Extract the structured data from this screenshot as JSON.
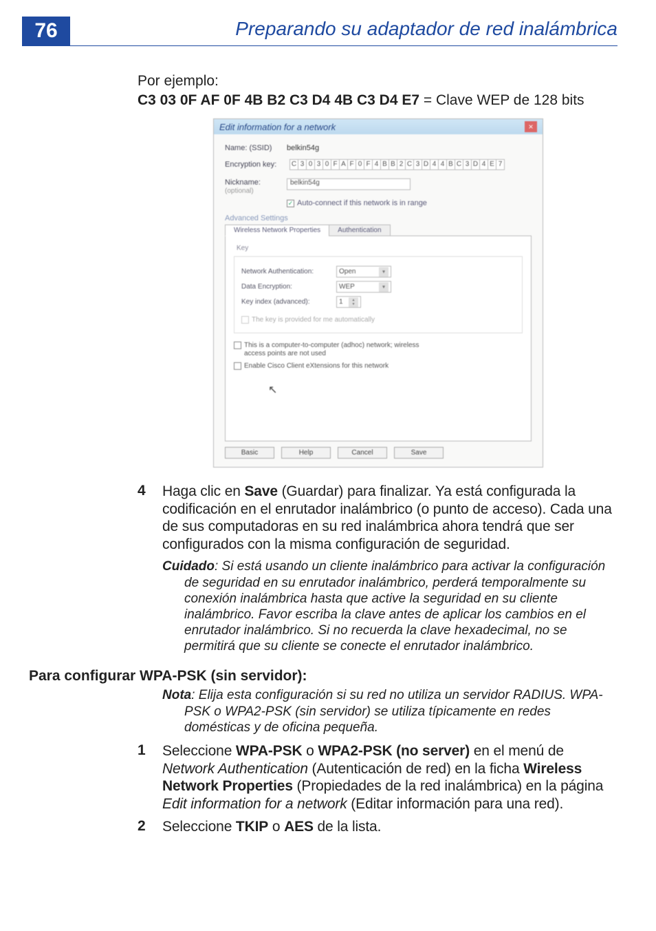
{
  "page_number": "76",
  "section_title": "Preparando su adaptador de red inalámbrica",
  "intro_label": "Por ejemplo:",
  "example_key_bold": "C3 03 0F AF 0F 4B B2 C3 D4 4B C3 D4 E7",
  "example_key_tail": " = Clave WEP de 128 bits",
  "screenshot": {
    "title": "Edit information for a network",
    "name_label": "Name: (SSID)",
    "name_value": "belkin54g",
    "enc_label": "Encryption key:",
    "enc_chars": [
      "C",
      "3",
      "0",
      "3",
      "0",
      "F",
      "A",
      "F",
      "0",
      "F",
      "4",
      "B",
      "B",
      "2",
      "C",
      "3",
      "D",
      "4",
      "4",
      "B",
      "C",
      "3",
      "D",
      "4",
      "E",
      "7"
    ],
    "nick_label": "Nickname:",
    "nick_sub": "(optional)",
    "nick_value": "belkin54g",
    "autoconnect": "Auto-connect if this network is in range",
    "adv_label": "Advanced Settings",
    "tab1": "Wireless Network Properties",
    "tab2": "Authentication",
    "key_label": "Key",
    "netauth_label": "Network Authentication:",
    "netauth_value": "Open",
    "dataenc_label": "Data Encryption:",
    "dataenc_value": "WEP",
    "keyidx_label": "Key index (advanced):",
    "keyidx_value": "1",
    "provided_auto": "The key is provided for me automatically",
    "adhoc_label": "This is a computer-to-computer (adhoc) network; wireless access points are not used",
    "cisco_label": "Enable Cisco Client eXtensions for this network",
    "btn_basic": "Basic",
    "btn_help": "Help",
    "btn_cancel": "Cancel",
    "btn_save": "Save"
  },
  "step4_num": "4",
  "step4_pre": "Haga clic en ",
  "step4_bold": "Save",
  "step4_post": " (Guardar) para finalizar. Ya está configurada la codificación en el enrutador inalámbrico (o punto de acceso). Cada una de sus computadoras en su red inalámbrica ahora tendrá que ser configurados con la misma configuración de seguridad.",
  "cuidado_label": "Cuidado",
  "cuidado_body": ": Si está usando un cliente inalámbrico para activar la configuración de seguridad en su enrutador inalámbrico, perderá temporalmente su conexión inalámbrica hasta que active la seguridad en su cliente inalámbrico. Favor escriba la clave antes de aplicar los cambios en el enrutador inalámbrico. Si no recuerda la clave hexadecimal, no se permitirá que su cliente se conecte el enrutador inalámbrico.",
  "sub_heading": "Para configurar WPA-PSK (sin servidor):",
  "nota_label": "Nota",
  "nota_body": ": Elija esta configuración si su red no utiliza un servidor RADIUS. WPA-PSK o WPA2-PSK (sin servidor) se utiliza típicamente en redes domésticas y de oficina pequeña.",
  "step1_num": "1",
  "s1_a": "Seleccione ",
  "s1_b": "WPA-PSK",
  "s1_c": " o ",
  "s1_d": "WPA2-PSK (no server)",
  "s1_e": " en el menú de ",
  "s1_f": "Network Authentication",
  "s1_g": " (Autenticación de red) en la ficha ",
  "s1_h": "Wireless Network Properties",
  "s1_i": " (Propiedades de la red inalámbrica) en la página ",
  "s1_j": "Edit information for a network",
  "s1_k": " (Editar información para una red).",
  "step2_num": "2",
  "s2_a": "Seleccione ",
  "s2_b": "TKIP",
  "s2_c": " o ",
  "s2_d": "AES",
  "s2_e": " de la lista."
}
